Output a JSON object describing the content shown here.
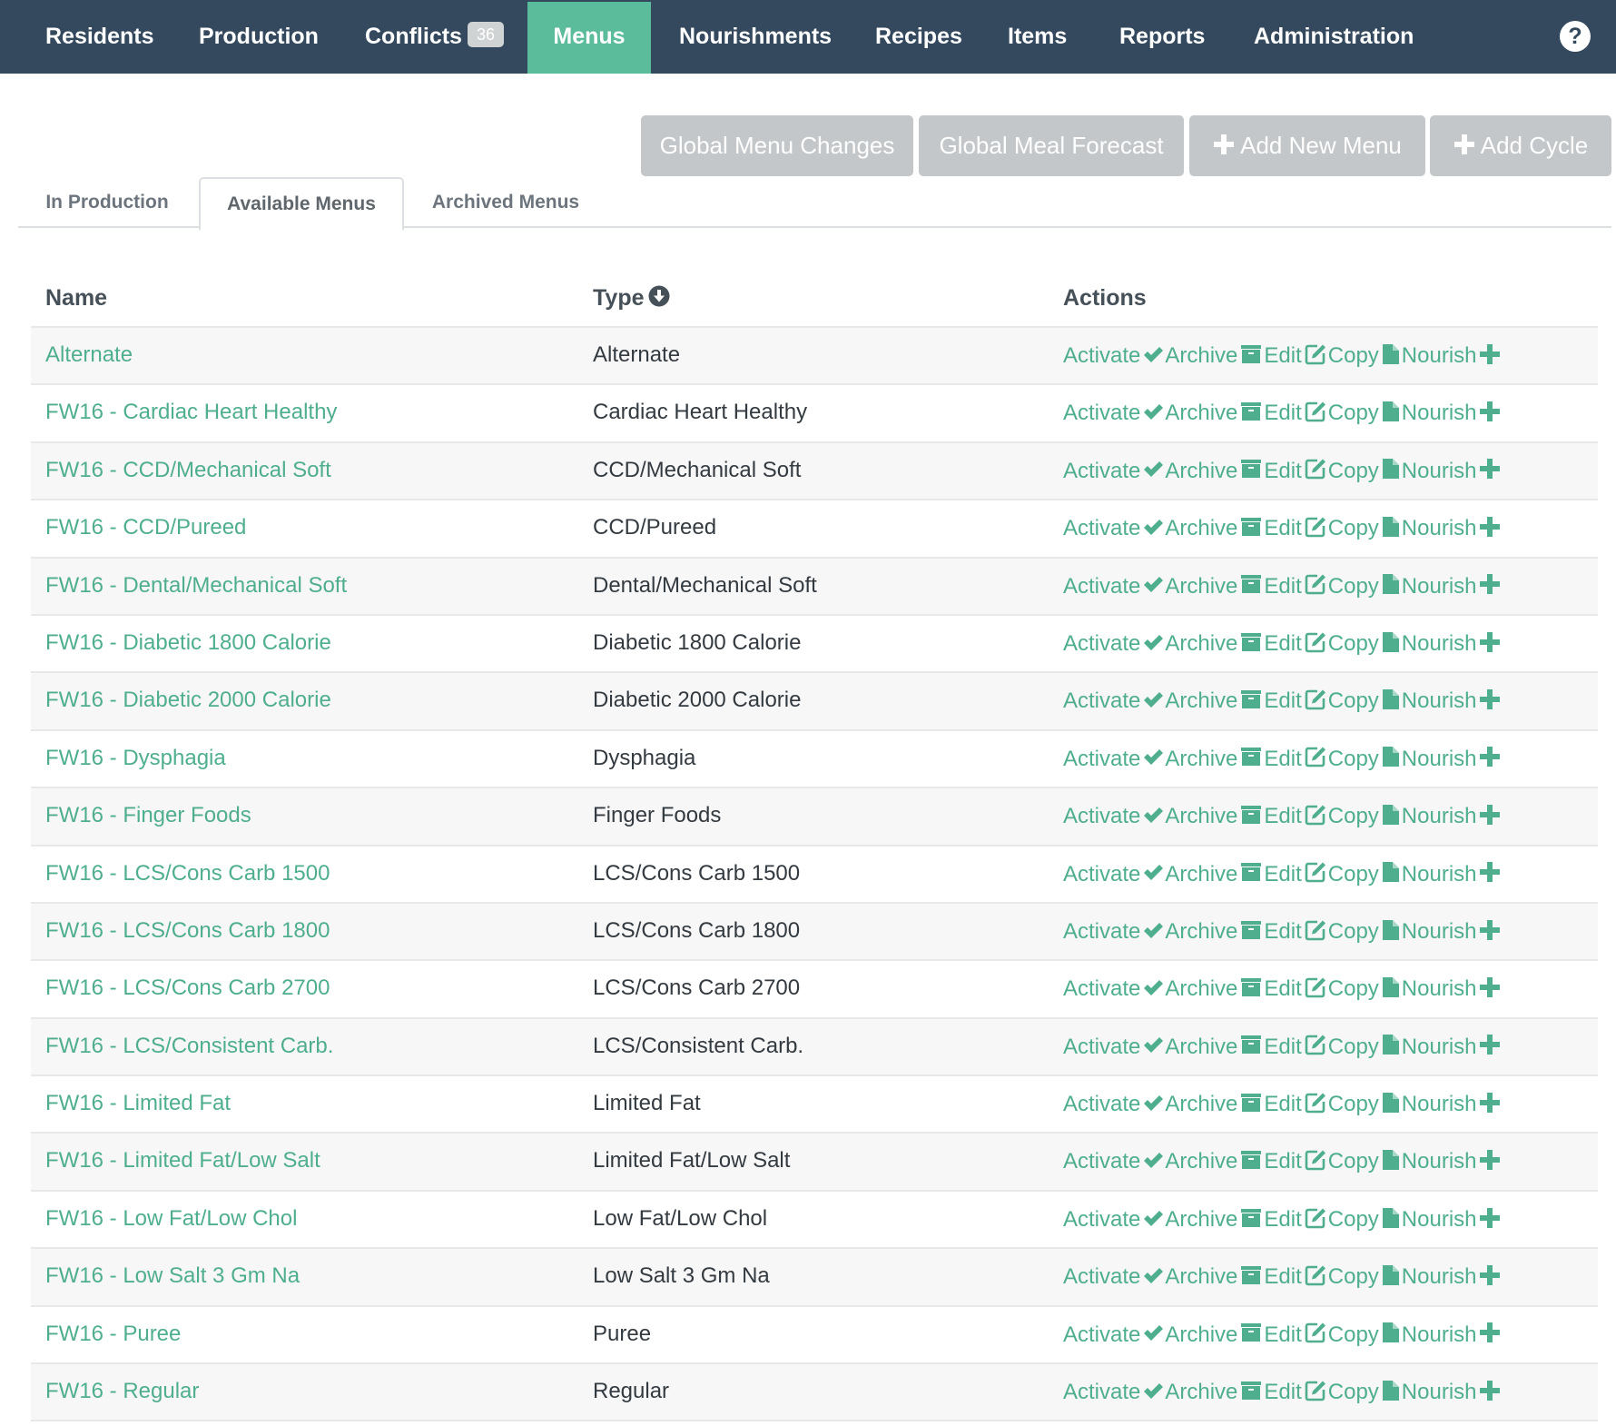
{
  "nav": {
    "items": [
      {
        "label": "Residents"
      },
      {
        "label": "Production"
      },
      {
        "label": "Conflicts",
        "badge": "36"
      },
      {
        "label": "Menus",
        "active": true
      },
      {
        "label": "Nourishments"
      },
      {
        "label": "Recipes"
      },
      {
        "label": "Items"
      },
      {
        "label": "Reports"
      },
      {
        "label": "Administration"
      }
    ],
    "help_glyph": "?"
  },
  "toolbar": {
    "global_menu_changes": "Global Menu Changes",
    "global_meal_forecast": "Global Meal Forecast",
    "add_new_menu": "Add New Menu",
    "add_cycle": "Add Cycle"
  },
  "tabs": [
    {
      "label": "In Production"
    },
    {
      "label": "Available Menus",
      "active": true
    },
    {
      "label": "Archived Menus"
    }
  ],
  "table": {
    "headers": {
      "name": "Name",
      "type": "Type",
      "actions": "Actions"
    },
    "action_labels": {
      "activate": "Activate",
      "archive": "Archive",
      "edit": "Edit",
      "copy": "Copy",
      "nourish": "Nourish"
    },
    "rows": [
      {
        "name": "Alternate",
        "type": "Alternate"
      },
      {
        "name": "FW16 - Cardiac Heart Healthy",
        "type": "Cardiac Heart Healthy"
      },
      {
        "name": "FW16 - CCD/Mechanical Soft",
        "type": "CCD/Mechanical Soft"
      },
      {
        "name": "FW16 - CCD/Pureed",
        "type": "CCD/Pureed"
      },
      {
        "name": "FW16 - Dental/Mechanical Soft",
        "type": "Dental/Mechanical Soft"
      },
      {
        "name": "FW16 - Diabetic 1800 Calorie",
        "type": "Diabetic 1800 Calorie"
      },
      {
        "name": "FW16 - Diabetic 2000 Calorie",
        "type": "Diabetic 2000 Calorie"
      },
      {
        "name": "FW16 - Dysphagia",
        "type": "Dysphagia"
      },
      {
        "name": "FW16 - Finger Foods",
        "type": "Finger Foods"
      },
      {
        "name": "FW16 - LCS/Cons Carb 1500",
        "type": "LCS/Cons Carb 1500"
      },
      {
        "name": "FW16 - LCS/Cons Carb 1800",
        "type": "LCS/Cons Carb 1800"
      },
      {
        "name": "FW16 - LCS/Cons Carb 2700",
        "type": "LCS/Cons Carb 2700"
      },
      {
        "name": "FW16 - LCS/Consistent Carb.",
        "type": "LCS/Consistent Carb."
      },
      {
        "name": "FW16 - Limited Fat",
        "type": "Limited Fat"
      },
      {
        "name": "FW16 - Limited Fat/Low Salt",
        "type": "Limited Fat/Low Salt"
      },
      {
        "name": "FW16 - Low Fat/Low Chol",
        "type": "Low Fat/Low Chol"
      },
      {
        "name": "FW16 - Low Salt 3 Gm Na",
        "type": "Low Salt 3 Gm Na"
      },
      {
        "name": "FW16 - Puree",
        "type": "Puree"
      },
      {
        "name": "FW16 - Regular",
        "type": "Regular"
      }
    ]
  },
  "colors": {
    "navbar": "#34495e",
    "accent": "#5bbc9c",
    "link": "#4fae8e",
    "toolbar_button": "#c3c7ca"
  },
  "icons": {
    "sort": "sort-down-circle-icon",
    "activate": "check-icon",
    "archive": "archive-box-icon",
    "edit": "edit-square-icon",
    "copy": "file-icon",
    "nourish": "plus-icon",
    "help": "question-circle-icon"
  }
}
